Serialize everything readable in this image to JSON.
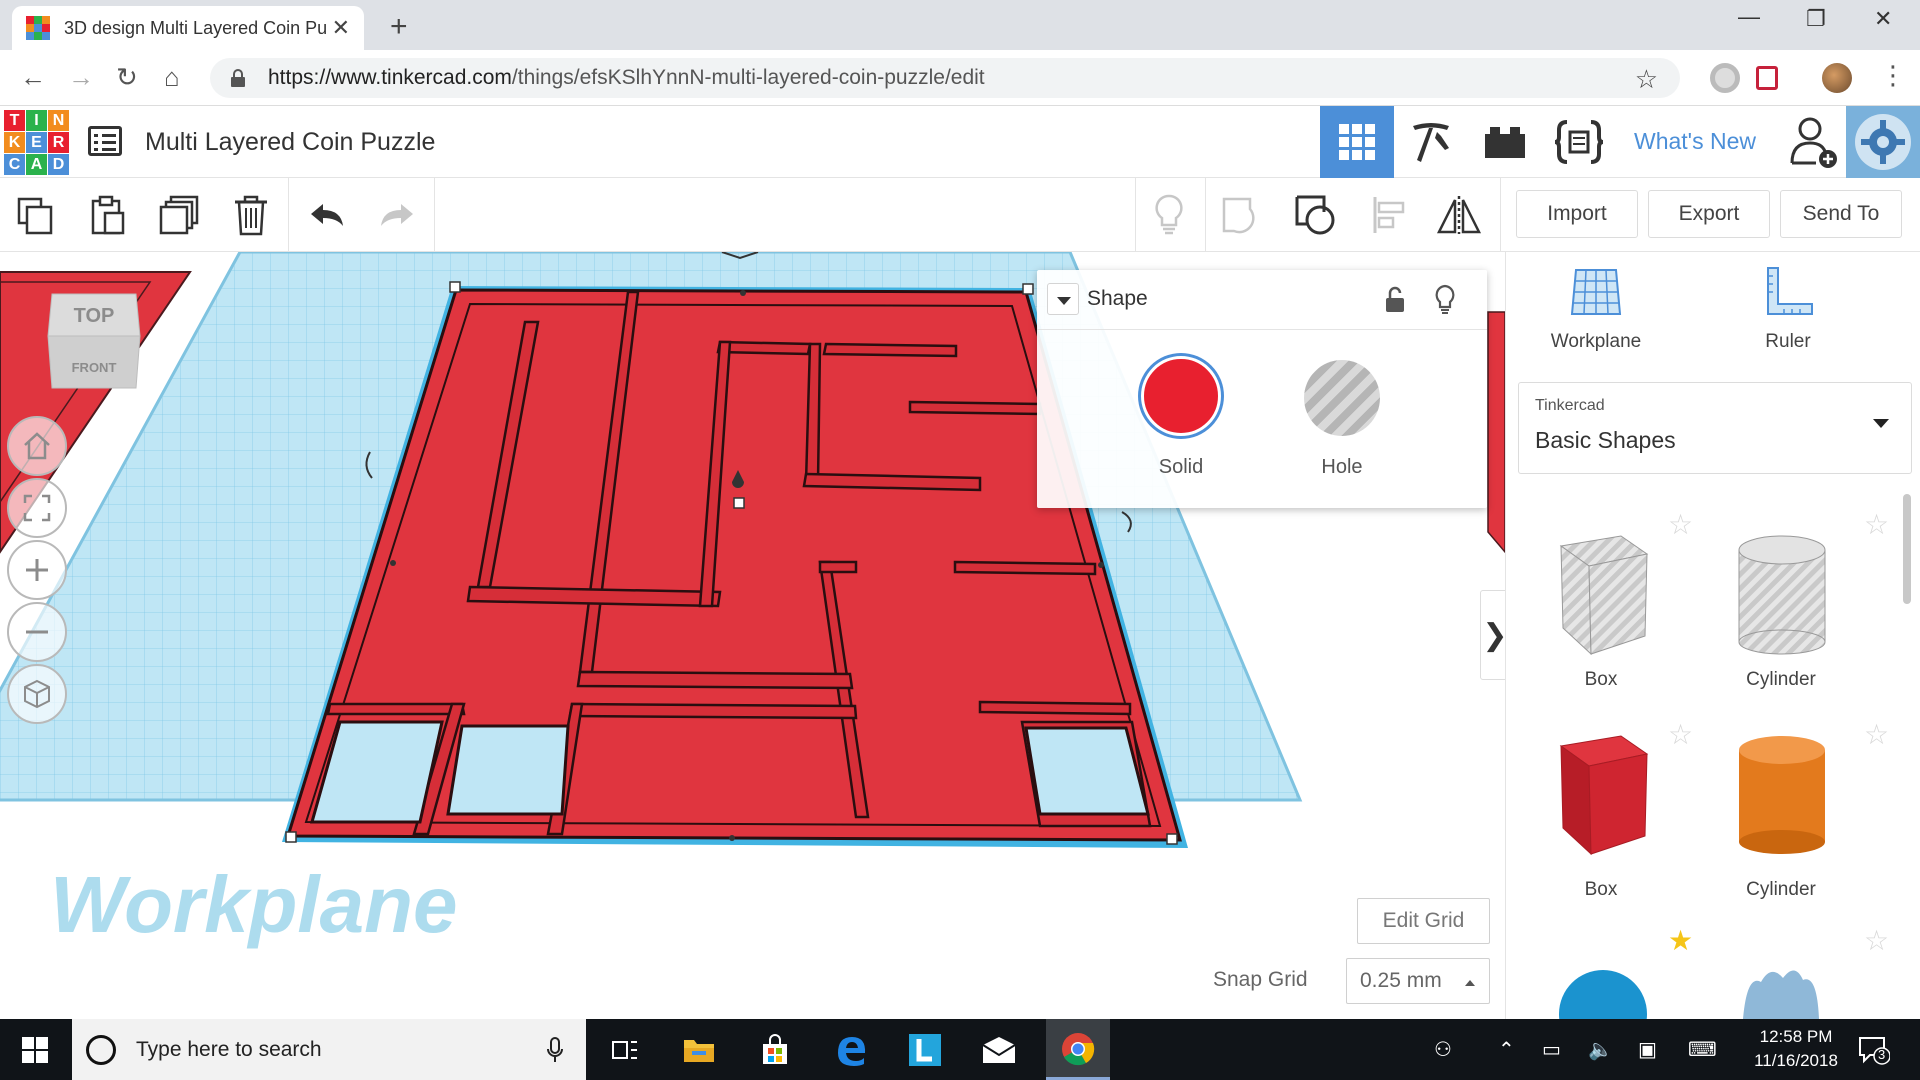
{
  "browser": {
    "tab_title": "3D design Multi Layered Coin Pu",
    "url_host": "https://www.tinkercad.com",
    "url_path": "/things/efsKSlhYnnN-multi-layered-coin-puzzle/edit"
  },
  "header": {
    "logo_letters": [
      "T",
      "I",
      "N",
      "K",
      "E",
      "R",
      "C",
      "A",
      "D"
    ],
    "design_title": "Multi Layered Coin Puzzle",
    "whats_new": "What's New"
  },
  "toolbar": {
    "import": "Import",
    "export": "Export",
    "send_to": "Send To"
  },
  "viewcube": {
    "top": "TOP",
    "front": "FRONT"
  },
  "workplane_label": "Workplane",
  "inspector": {
    "title": "Shape",
    "solid_label": "Solid",
    "hole_label": "Hole",
    "solid_color": "#e8202f"
  },
  "grid": {
    "edit_grid": "Edit Grid",
    "snap_label": "Snap Grid",
    "snap_value": "0.25 mm"
  },
  "right_panel": {
    "workplane": "Workplane",
    "ruler": "Ruler",
    "library_category": "Tinkercad",
    "library_value": "Basic Shapes",
    "shapes": [
      {
        "name": "Box"
      },
      {
        "name": "Cylinder"
      },
      {
        "name": "Box"
      },
      {
        "name": "Cylinder"
      }
    ]
  },
  "taskbar": {
    "search_placeholder": "Type here to search",
    "time": "12:58 PM",
    "date": "11/16/2018",
    "notifications": "3"
  },
  "colors": {
    "accent": "#4c8fd8",
    "model_red": "#e0353f",
    "grid_blue": "#a9dcef"
  }
}
